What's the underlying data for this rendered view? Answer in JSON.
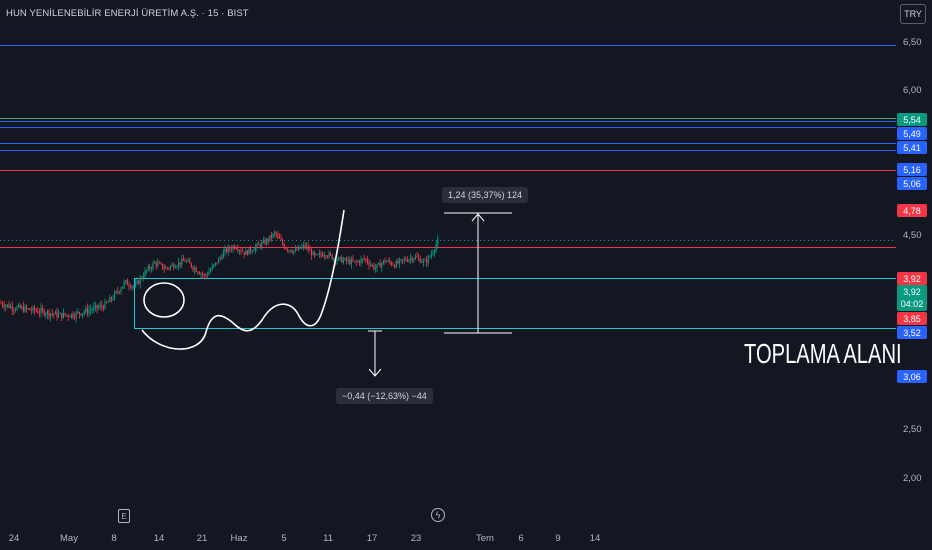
{
  "header": {
    "title": "HUN YENİLENEBİLİR ENERJİ ÜRETİM A.Ş. · 15 · BIST",
    "currency": "TRY"
  },
  "price_axis": {
    "ticks": [
      "6,50",
      "6,00",
      "4,50",
      "2,50",
      "2,00"
    ]
  },
  "level_badges": [
    {
      "label": "5,54",
      "color": "#089981"
    },
    {
      "label": "5,49",
      "color": "#2962ff"
    },
    {
      "label": "5,41",
      "color": "#2962ff"
    },
    {
      "label": "5,16",
      "color": "#2962ff"
    },
    {
      "label": "5,06",
      "color": "#2962ff"
    },
    {
      "label": "4,78",
      "color": "#f23645"
    },
    {
      "label": "3,92",
      "color": "#f23645"
    },
    {
      "label": "3,85",
      "color": "#f23645"
    },
    {
      "label": "3,52",
      "color": "#2962ff"
    },
    {
      "label": "3,06",
      "color": "#2962ff"
    }
  ],
  "last_price": {
    "price": "3,92",
    "countdown": "04:02",
    "color": "#089981"
  },
  "date_axis": {
    "ticks": [
      "24",
      "May",
      "8",
      "14",
      "21",
      "Haz",
      "5",
      "11",
      "17",
      "23",
      "Tem",
      "6",
      "9",
      "14"
    ]
  },
  "measurements": {
    "up": "1,24 (35,37%) 124",
    "down": "−0,44 (−12,63%) −44"
  },
  "annotation": "TOPLAMA ALANI",
  "icons": {
    "earnings": "E",
    "dividends": "ϟ"
  },
  "chart_data": {
    "type": "candlestick",
    "symbol": "HUN YENİLENEBİLİR ENERJİ ÜRETİM A.Ş.",
    "interval": "15",
    "exchange": "BIST",
    "y_scale": "log",
    "ylim": [
      1.8,
      7.0
    ],
    "price_ticks": [
      6.5,
      6.0,
      4.5,
      2.5,
      2.0
    ],
    "horizontal_levels": [
      {
        "value": 6.82,
        "color": "#2962ff",
        "label": null
      },
      {
        "value": 5.54,
        "color": "#4caf50",
        "label": "5,54"
      },
      {
        "value": 5.49,
        "color": "#2962ff",
        "label": "5,49"
      },
      {
        "value": 5.41,
        "color": "#2962ff",
        "label": "5,41"
      },
      {
        "value": 5.16,
        "color": "#2962ff",
        "label": "5,16"
      },
      {
        "value": 5.06,
        "color": "#2962ff",
        "label": "5,06"
      },
      {
        "value": 4.78,
        "color": "#f23645",
        "label": "4,78"
      },
      {
        "value": 3.85,
        "color": "#f23645",
        "label": "3,85"
      }
    ],
    "accumulation_zone": {
      "from": 3.06,
      "to": 3.52,
      "color": "#26c6da",
      "label": "TOPLAMA ALANI"
    },
    "measure_up": {
      "from": 3.52,
      "to": 4.76,
      "change": 1.24,
      "percent": 35.37,
      "ticks": 124
    },
    "measure_down": {
      "from": 3.52,
      "to": 3.08,
      "change": -0.44,
      "percent": -12.63,
      "ticks": -44
    },
    "last_price": 3.92,
    "price_path": [
      [
        0,
        3.28
      ],
      [
        15,
        3.24
      ],
      [
        30,
        3.22
      ],
      [
        45,
        3.2
      ],
      [
        60,
        3.17
      ],
      [
        75,
        3.18
      ],
      [
        90,
        3.22
      ],
      [
        105,
        3.26
      ],
      [
        115,
        3.36
      ],
      [
        125,
        3.48
      ],
      [
        135,
        3.44
      ],
      [
        145,
        3.58
      ],
      [
        155,
        3.68
      ],
      [
        165,
        3.62
      ],
      [
        175,
        3.66
      ],
      [
        185,
        3.7
      ],
      [
        195,
        3.62
      ],
      [
        205,
        3.54
      ],
      [
        215,
        3.66
      ],
      [
        225,
        3.8
      ],
      [
        235,
        3.86
      ],
      [
        245,
        3.78
      ],
      [
        255,
        3.84
      ],
      [
        265,
        3.9
      ],
      [
        275,
        4.0
      ],
      [
        285,
        3.84
      ],
      [
        295,
        3.8
      ],
      [
        305,
        3.86
      ],
      [
        315,
        3.74
      ],
      [
        325,
        3.78
      ],
      [
        335,
        3.72
      ],
      [
        345,
        3.7
      ],
      [
        355,
        3.68
      ],
      [
        365,
        3.72
      ],
      [
        375,
        3.62
      ],
      [
        385,
        3.7
      ],
      [
        395,
        3.66
      ],
      [
        405,
        3.71
      ],
      [
        415,
        3.74
      ],
      [
        425,
        3.68
      ],
      [
        432,
        3.78
      ],
      [
        438,
        3.92
      ]
    ]
  }
}
